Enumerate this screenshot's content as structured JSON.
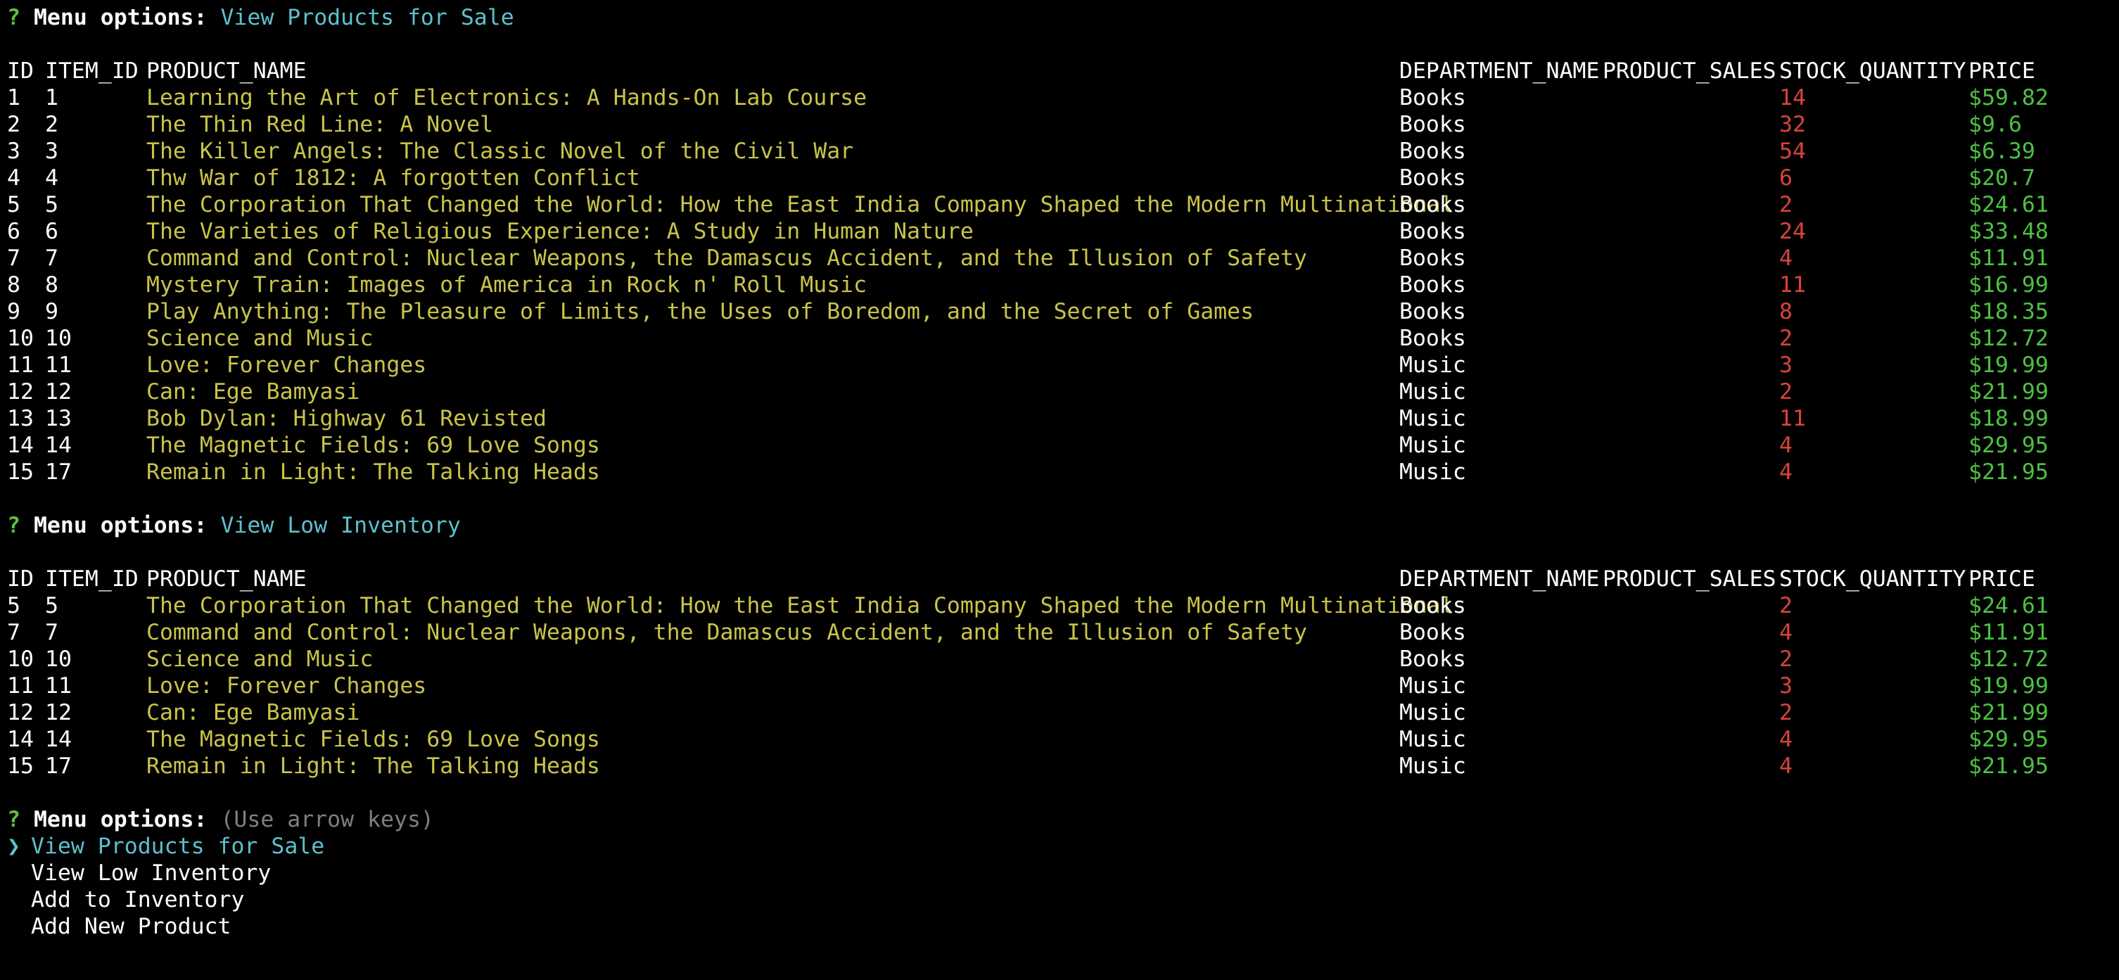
{
  "prompt": {
    "mark": "?",
    "label": "Menu options:",
    "hint": "(Use arrow keys)"
  },
  "headers": [
    "ID",
    "ITEM_ID",
    "PRODUCT_NAME",
    "DEPARTMENT_NAME",
    "PRODUCT_SALES",
    "STOCK_QUANTITY",
    "PRICE"
  ],
  "sections": [
    {
      "answer": "View Products for Sale",
      "rows": [
        {
          "id": "1",
          "item_id": "1",
          "name": "Learning the Art of Electronics: A Hands-On Lab Course",
          "dept": "Books",
          "stock": "14",
          "price": "$59.82"
        },
        {
          "id": "2",
          "item_id": "2",
          "name": "The Thin Red Line: A Novel",
          "dept": "Books",
          "stock": "32",
          "price": "$9.6"
        },
        {
          "id": "3",
          "item_id": "3",
          "name": "The Killer Angels: The Classic Novel of the Civil War",
          "dept": "Books",
          "stock": "54",
          "price": "$6.39"
        },
        {
          "id": "4",
          "item_id": "4",
          "name": "Thw War of 1812: A forgotten Conflict",
          "dept": "Books",
          "stock": "6",
          "price": "$20.7"
        },
        {
          "id": "5",
          "item_id": "5",
          "name": "The Corporation That Changed the World: How the East India Company Shaped the Modern Multinational",
          "dept": "Books",
          "stock": "2",
          "price": "$24.61"
        },
        {
          "id": "6",
          "item_id": "6",
          "name": "The Varieties of Religious Experience: A Study in Human Nature",
          "dept": "Books",
          "stock": "24",
          "price": "$33.48"
        },
        {
          "id": "7",
          "item_id": "7",
          "name": "Command and Control: Nuclear Weapons, the Damascus Accident, and the Illusion of Safety",
          "dept": "Books",
          "stock": "4",
          "price": "$11.91"
        },
        {
          "id": "8",
          "item_id": "8",
          "name": "Mystery Train: Images of America in Rock n' Roll Music",
          "dept": "Books",
          "stock": "11",
          "price": "$16.99"
        },
        {
          "id": "9",
          "item_id": "9",
          "name": "Play Anything: The Pleasure of Limits, the Uses of Boredom, and the Secret of Games",
          "dept": "Books",
          "stock": "8",
          "price": "$18.35"
        },
        {
          "id": "10",
          "item_id": "10",
          "name": "Science and Music",
          "dept": "Books",
          "stock": "2",
          "price": "$12.72"
        },
        {
          "id": "11",
          "item_id": "11",
          "name": "Love: Forever Changes",
          "dept": "Music",
          "stock": "3",
          "price": "$19.99"
        },
        {
          "id": "12",
          "item_id": "12",
          "name": "Can: Ege Bamyasi",
          "dept": "Music",
          "stock": "2",
          "price": "$21.99"
        },
        {
          "id": "13",
          "item_id": "13",
          "name": "Bob Dylan: Highway 61 Revisted",
          "dept": "Music",
          "stock": "11",
          "price": "$18.99"
        },
        {
          "id": "14",
          "item_id": "14",
          "name": "The Magnetic Fields: 69 Love Songs",
          "dept": "Music",
          "stock": "4",
          "price": "$29.95"
        },
        {
          "id": "15",
          "item_id": "17",
          "name": "Remain in Light: The Talking Heads",
          "dept": "Music",
          "stock": "4",
          "price": "$21.95"
        }
      ]
    },
    {
      "answer": "View Low Inventory",
      "rows": [
        {
          "id": "5",
          "item_id": "5",
          "name": "The Corporation That Changed the World: How the East India Company Shaped the Modern Multinational",
          "dept": "Books",
          "stock": "2",
          "price": "$24.61"
        },
        {
          "id": "7",
          "item_id": "7",
          "name": "Command and Control: Nuclear Weapons, the Damascus Accident, and the Illusion of Safety",
          "dept": "Books",
          "stock": "4",
          "price": "$11.91"
        },
        {
          "id": "10",
          "item_id": "10",
          "name": "Science and Music",
          "dept": "Books",
          "stock": "2",
          "price": "$12.72"
        },
        {
          "id": "11",
          "item_id": "11",
          "name": "Love: Forever Changes",
          "dept": "Music",
          "stock": "3",
          "price": "$19.99"
        },
        {
          "id": "12",
          "item_id": "12",
          "name": "Can: Ege Bamyasi",
          "dept": "Music",
          "stock": "2",
          "price": "$21.99"
        },
        {
          "id": "14",
          "item_id": "14",
          "name": "The Magnetic Fields: 69 Love Songs",
          "dept": "Music",
          "stock": "4",
          "price": "$29.95"
        },
        {
          "id": "15",
          "item_id": "17",
          "name": "Remain in Light: The Talking Heads",
          "dept": "Music",
          "stock": "4",
          "price": "$21.95"
        }
      ]
    }
  ],
  "menu": {
    "pointer": "❯",
    "selected_index": 0,
    "options": [
      "View Products for Sale",
      "View Low Inventory",
      "Add to Inventory",
      "Add New Product"
    ]
  },
  "colors": {
    "background": "#000000",
    "prompt_mark": "#5fbf3f",
    "answer": "#5ec0cf",
    "product_name": "#c9c449",
    "stock": "#d6443a",
    "price": "#4cc142",
    "hint": "#7f7f7f"
  }
}
